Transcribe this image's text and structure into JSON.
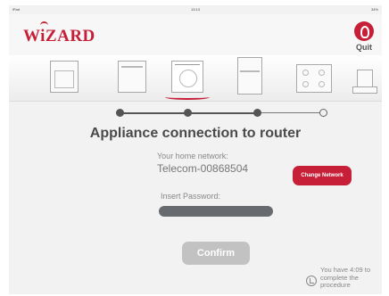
{
  "status_bar": {
    "carrier": "iPad",
    "time": "13:13",
    "battery": "34%"
  },
  "header": {
    "logo": "WiZARD",
    "quit_label": "Quit"
  },
  "appliances": [
    "oven",
    "dishwasher",
    "washing-machine",
    "fridge",
    "hob",
    "hood"
  ],
  "selected_appliance": "washing-machine",
  "stepper": {
    "total_steps": 4,
    "completed_steps": 3
  },
  "title": "Appliance connection to router",
  "network": {
    "caption": "Your home network:",
    "value": "Telecom-00868504",
    "change_label": "Change Network"
  },
  "password": {
    "caption": "Insert Password:",
    "value": ""
  },
  "confirm_label": "Confirm",
  "timer_text": "You have 4:09 to complete the procedure",
  "colors": {
    "accent": "#c71f37",
    "field": "#676b70",
    "disabled": "#c2c2c2"
  }
}
